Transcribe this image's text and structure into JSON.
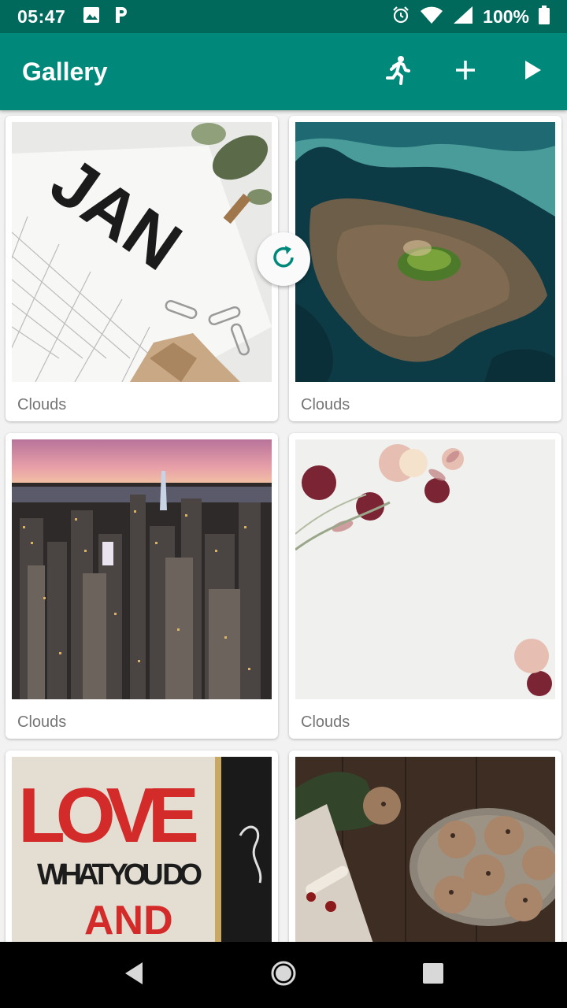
{
  "status_bar": {
    "time": "05:47",
    "battery": "100%",
    "icons": [
      "image-icon",
      "parking-icon",
      "alarm-icon",
      "wifi-icon",
      "signal-icon",
      "battery-icon"
    ]
  },
  "app_bar": {
    "title": "Gallery",
    "actions": [
      "run-icon",
      "add-icon",
      "play-icon"
    ]
  },
  "grid": {
    "items": [
      {
        "caption": "Clouds",
        "image": "calendar-jan-photo"
      },
      {
        "caption": "Clouds",
        "image": "aerial-island-photo"
      },
      {
        "caption": "Clouds",
        "image": "city-skyline-photo"
      },
      {
        "caption": "Clouds",
        "image": "flowers-photo"
      },
      {
        "caption": "",
        "image": "love-sign-photo",
        "sign_text": [
          "LOVE",
          "WHAT YOU DO",
          "AND"
        ]
      },
      {
        "caption": "",
        "image": "cookies-photo"
      }
    ],
    "calendar_text": "JAN"
  },
  "colors": {
    "status_bar": "#00695c",
    "app_bar": "#00897b",
    "accent": "#00897b"
  }
}
